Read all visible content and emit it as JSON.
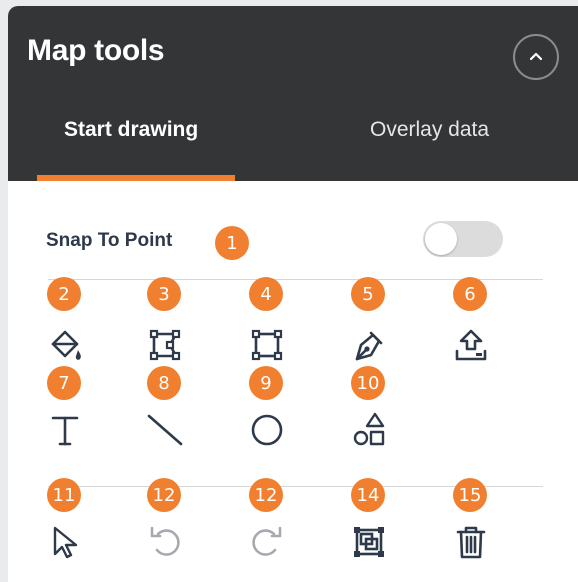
{
  "panel": {
    "title": "Map tools",
    "collapse_icon": "chevron-up-icon"
  },
  "tabs": [
    {
      "label": "Start drawing",
      "active": true
    },
    {
      "label": "Overlay data",
      "active": false
    }
  ],
  "snap": {
    "label": "Snap To Point",
    "enabled": false
  },
  "badges": [
    "1",
    "2",
    "3",
    "4",
    "5",
    "6",
    "7",
    "8",
    "9",
    "10",
    "11",
    "12",
    "12",
    "14",
    "15"
  ],
  "tools": [
    {
      "icon": "fill-bucket-icon"
    },
    {
      "icon": "polygon-icon"
    },
    {
      "icon": "rectangle-icon"
    },
    {
      "icon": "pen-icon"
    },
    {
      "icon": "upload-icon"
    },
    {
      "icon": "text-icon"
    },
    {
      "icon": "line-icon"
    },
    {
      "icon": "circle-icon"
    },
    {
      "icon": "shapes-icon"
    },
    {
      "icon": "select-pointer-icon"
    },
    {
      "icon": "undo-icon",
      "disabled": true
    },
    {
      "icon": "redo-icon",
      "disabled": true
    },
    {
      "icon": "group-icon"
    },
    {
      "icon": "trash-icon"
    }
  ],
  "colors": {
    "header": "#333537",
    "accent": "#f0802f",
    "icon": "#2e3a4a",
    "disabled_icon": "#a6aab0"
  }
}
